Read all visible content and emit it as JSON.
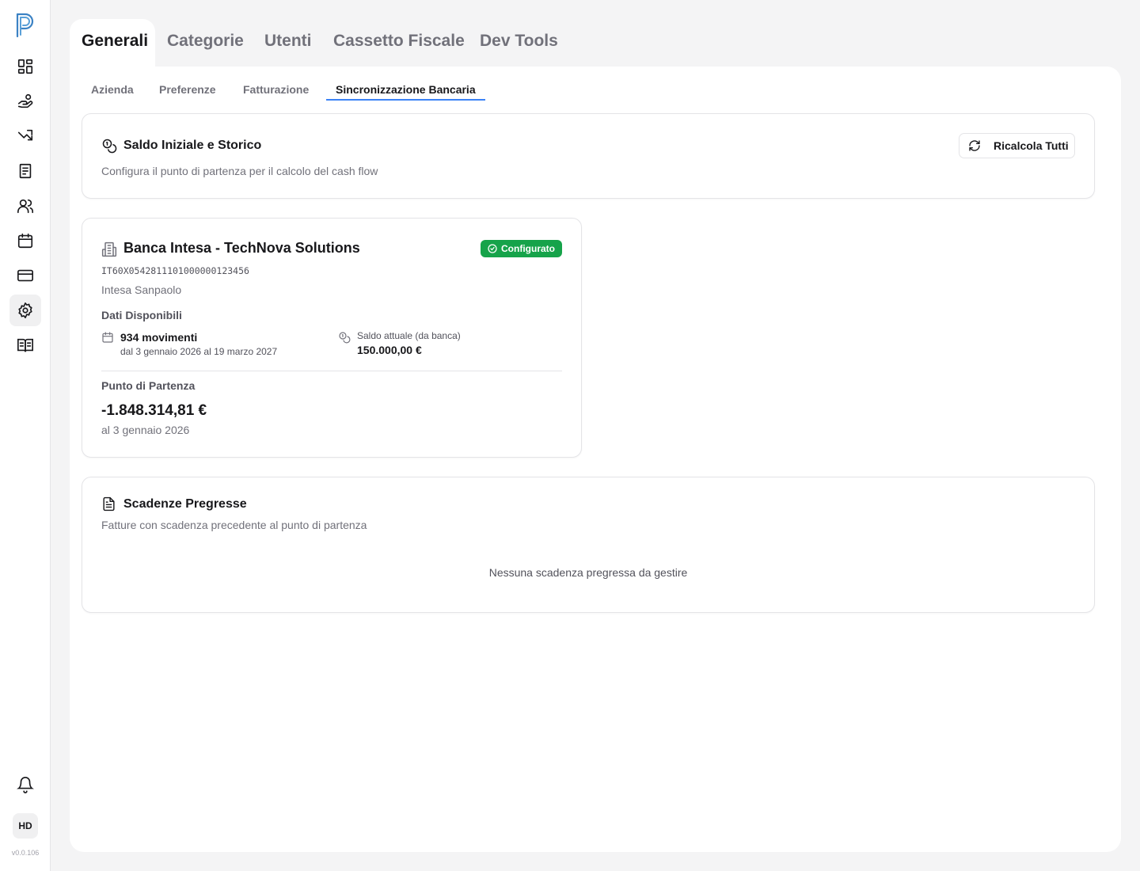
{
  "sidebar": {
    "items": [
      {
        "name": "dashboard",
        "icon": "dashboard-icon"
      },
      {
        "name": "payments",
        "icon": "hand-coins-icon"
      },
      {
        "name": "trends",
        "icon": "trend-icon"
      },
      {
        "name": "invoices",
        "icon": "receipt-icon"
      },
      {
        "name": "contacts",
        "icon": "users-icon"
      },
      {
        "name": "calendar",
        "icon": "calendar-icon"
      },
      {
        "name": "cards",
        "icon": "credit-card-icon"
      },
      {
        "name": "settings",
        "icon": "gear-icon",
        "active": true
      },
      {
        "name": "docs",
        "icon": "book-icon"
      }
    ],
    "notifications_icon": "bell-icon",
    "avatar_initials": "HD",
    "version": "v0.0.106"
  },
  "top_tabs": [
    "Generali",
    "Categorie",
    "Utenti",
    "Cassetto Fiscale",
    "Dev Tools"
  ],
  "active_top_tab": "Generali",
  "sub_tabs": [
    "Azienda",
    "Preferenze",
    "Fatturazione",
    "Sincronizzazione Bancaria"
  ],
  "active_sub_tab": "Sincronizzazione Bancaria",
  "saldo_card": {
    "title": "Saldo Iniziale e Storico",
    "subtitle": "Configura il punto di partenza per il calcolo del cash flow",
    "button_label": "Ricalcola Tutti"
  },
  "bank_card": {
    "title": "Banca Intesa - TechNova Solutions",
    "status": "Configurato",
    "iban": "IT60X0542811101000000123456",
    "bank_name": "Intesa Sanpaolo",
    "section_label": "Dati Disponibili",
    "movements_count": "934 movimenti",
    "movements_range": "dal 3 gennaio 2026 al 19 marzo 2027",
    "balance_label": "Saldo attuale (da banca)",
    "balance_value": "150.000,00 €",
    "start_label": "Punto di Partenza",
    "start_value": "-1.848.314,81 €",
    "start_date": "al 3 gennaio 2026"
  },
  "scadenze_card": {
    "title": "Scadenze Pregresse",
    "subtitle": "Fatture con scadenza precedente al punto di partenza",
    "empty_message": "Nessuna scadenza pregressa da gestire"
  },
  "colors": {
    "accent": "#3b82f6",
    "success": "#16a34a",
    "background": "#f4f4f5"
  }
}
